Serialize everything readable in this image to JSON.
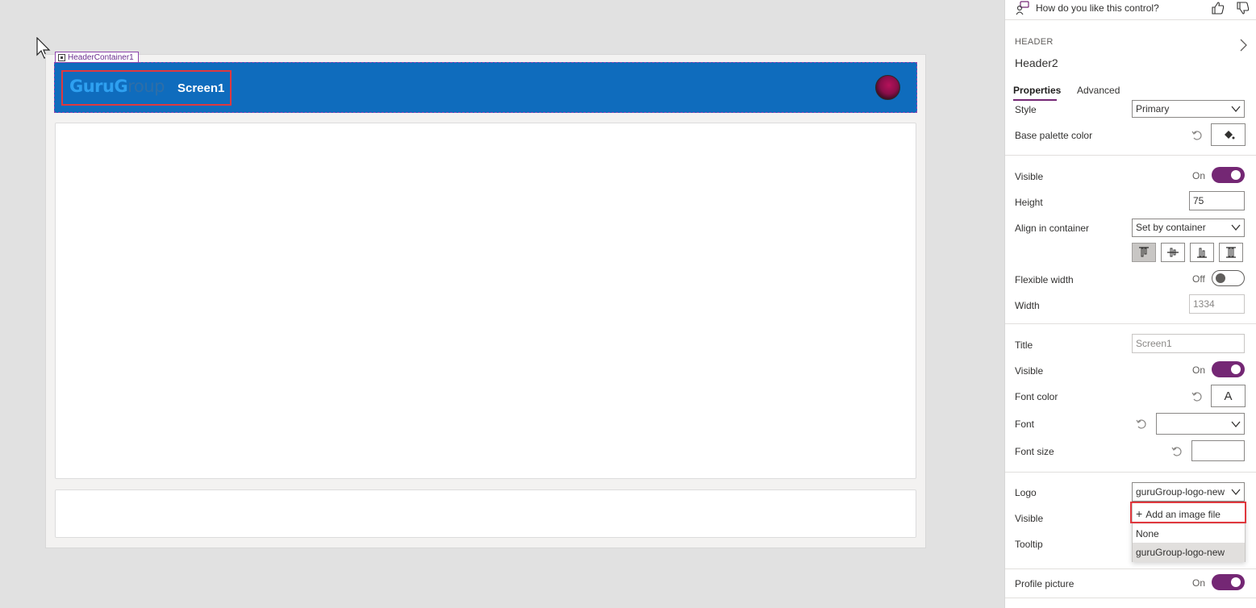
{
  "canvas": {
    "container_label": "HeaderContainer1",
    "header": {
      "logo_part1": "GuruG",
      "logo_part2": "roup",
      "title": "Screen1"
    }
  },
  "panel": {
    "feedback_prompt": "How do you like this control?",
    "control_type": "HEADER",
    "control_name": "Header2",
    "tabs": [
      "Properties",
      "Advanced"
    ],
    "style": {
      "label": "Style",
      "value": "Primary"
    },
    "base_palette_color": {
      "label": "Base palette color"
    },
    "visible": {
      "label": "Visible",
      "state": "On"
    },
    "height": {
      "label": "Height",
      "value": "75"
    },
    "align": {
      "label": "Align in container",
      "value": "Set by container",
      "buttons": [
        "align-top",
        "align-middle",
        "align-bottom",
        "align-stretch"
      ]
    },
    "flexible_width": {
      "label": "Flexible width",
      "state": "Off"
    },
    "width": {
      "label": "Width",
      "value": "1334"
    },
    "title": {
      "label": "Title",
      "value": "Screen1"
    },
    "title_visible": {
      "label": "Visible",
      "state": "On"
    },
    "font_color": {
      "label": "Font color",
      "glyph": "A"
    },
    "font": {
      "label": "Font",
      "value": ""
    },
    "font_size": {
      "label": "Font size",
      "value": ""
    },
    "logo": {
      "label": "Logo",
      "value": "guruGroup-logo-new",
      "dropdown": {
        "add_label": "Add an image file",
        "options": [
          "None",
          "guruGroup-logo-new"
        ]
      }
    },
    "logo_visible": {
      "label": "Visible"
    },
    "tooltip": {
      "label": "Tooltip"
    },
    "profile_picture": {
      "label": "Profile picture",
      "state": "On"
    }
  },
  "colors": {
    "header_bg": "#0f6cbd",
    "accent": "#742774",
    "highlight": "#e0383e"
  }
}
